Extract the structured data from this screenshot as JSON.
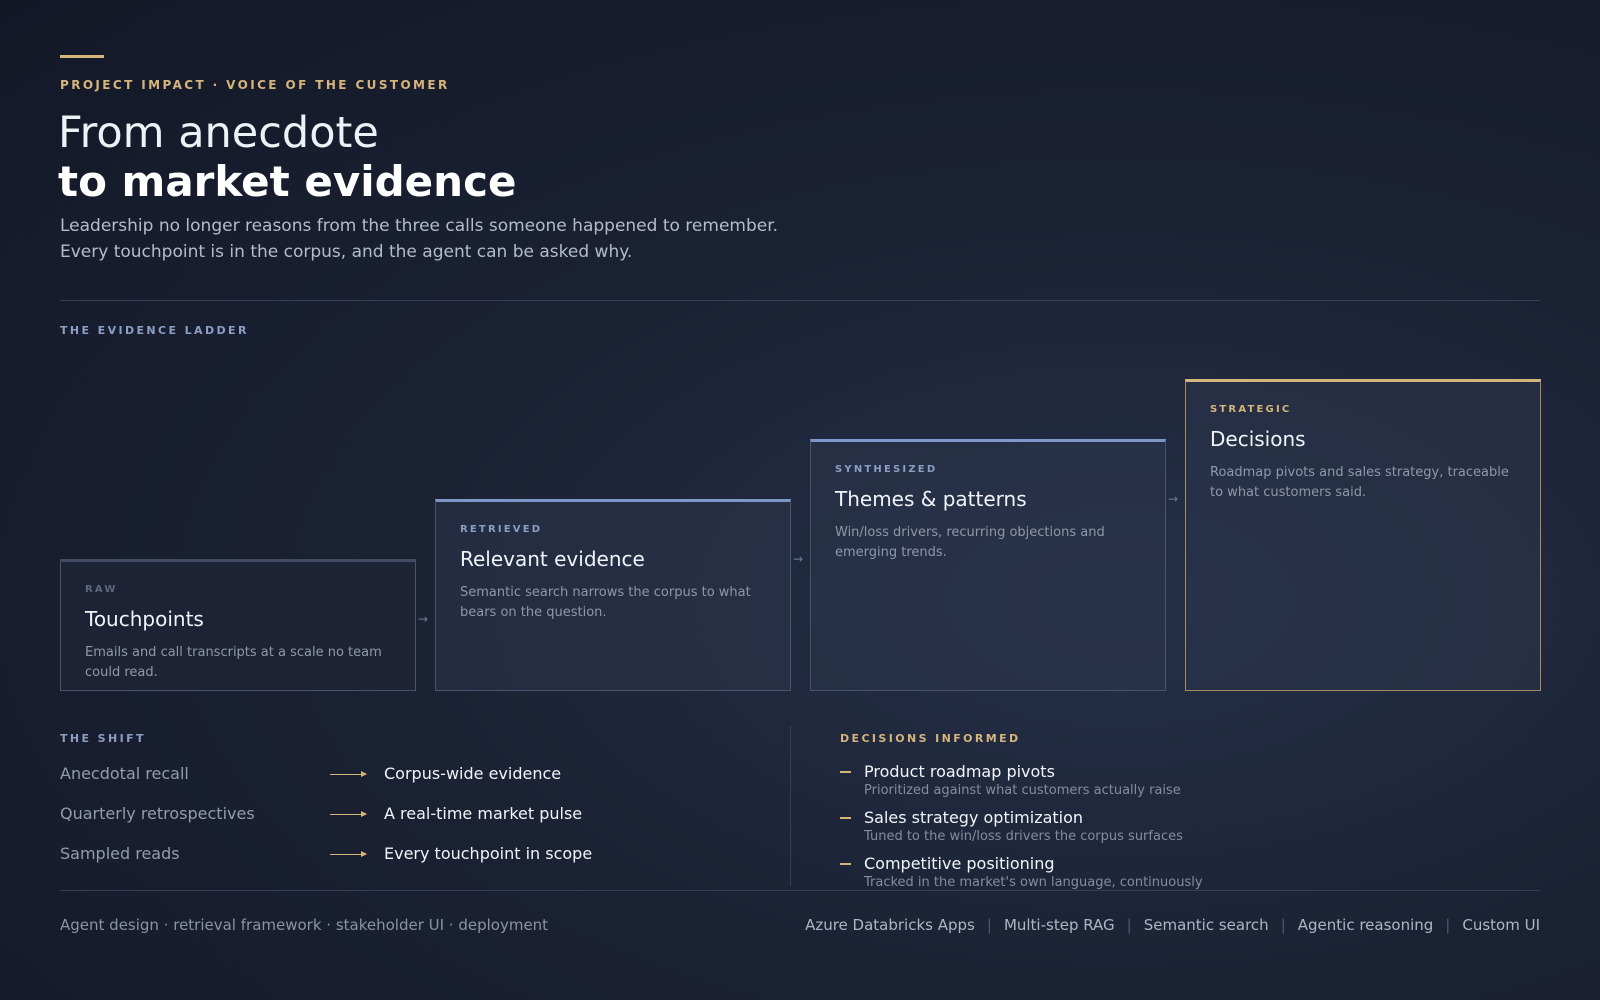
{
  "header": {
    "eyebrow": "PROJECT IMPACT  ·  VOICE OF THE CUSTOMER",
    "title_line1": "From anecdote",
    "title_line2": "to market evidence",
    "subtitle_line1": "Leadership no longer reasons from the three calls someone happened to remember.",
    "subtitle_line2": "Every touchpoint is in the corpus, and the agent can be asked why."
  },
  "ladder": {
    "label": "THE EVIDENCE LADDER",
    "steps": [
      {
        "tier": "RAW",
        "title": "Touchpoints",
        "description": "Emails and call transcripts at a scale no team could read."
      },
      {
        "tier": "RETRIEVED",
        "title": "Relevant evidence",
        "description": "Semantic search narrows the corpus to what bears on the question."
      },
      {
        "tier": "SYNTHESIZED",
        "title": "Themes & patterns",
        "description": "Win/loss drivers, recurring objections and emerging trends."
      },
      {
        "tier": "STRATEGIC",
        "title": "Decisions",
        "description": "Roadmap pivots and sales strategy, traceable to what customers said."
      }
    ]
  },
  "shift": {
    "label": "THE SHIFT",
    "rows": [
      {
        "from": "Anecdotal recall",
        "to": "Corpus-wide evidence"
      },
      {
        "from": "Quarterly retrospectives",
        "to": "A real-time market pulse"
      },
      {
        "from": "Sampled reads",
        "to": "Every touchpoint in scope"
      }
    ]
  },
  "decisions": {
    "label": "DECISIONS INFORMED",
    "items": [
      {
        "title": "Product roadmap pivots",
        "subtitle": "Prioritized against what customers actually raise"
      },
      {
        "title": "Sales strategy optimization",
        "subtitle": "Tuned to the win/loss drivers the corpus surfaces"
      },
      {
        "title": "Competitive positioning",
        "subtitle": "Tracked in the market's own language, continuously"
      }
    ]
  },
  "footer": {
    "scope": "Agent design · retrieval framework · stakeholder UI · deployment",
    "tags": [
      "Azure Databricks Apps",
      "Multi-step RAG",
      "Semantic search",
      "Agentic reasoning",
      "Custom UI"
    ]
  },
  "colors": {
    "accent_gold": "#d6b57a",
    "accent_blue": "#7f97c8",
    "background": "#1b2234"
  }
}
